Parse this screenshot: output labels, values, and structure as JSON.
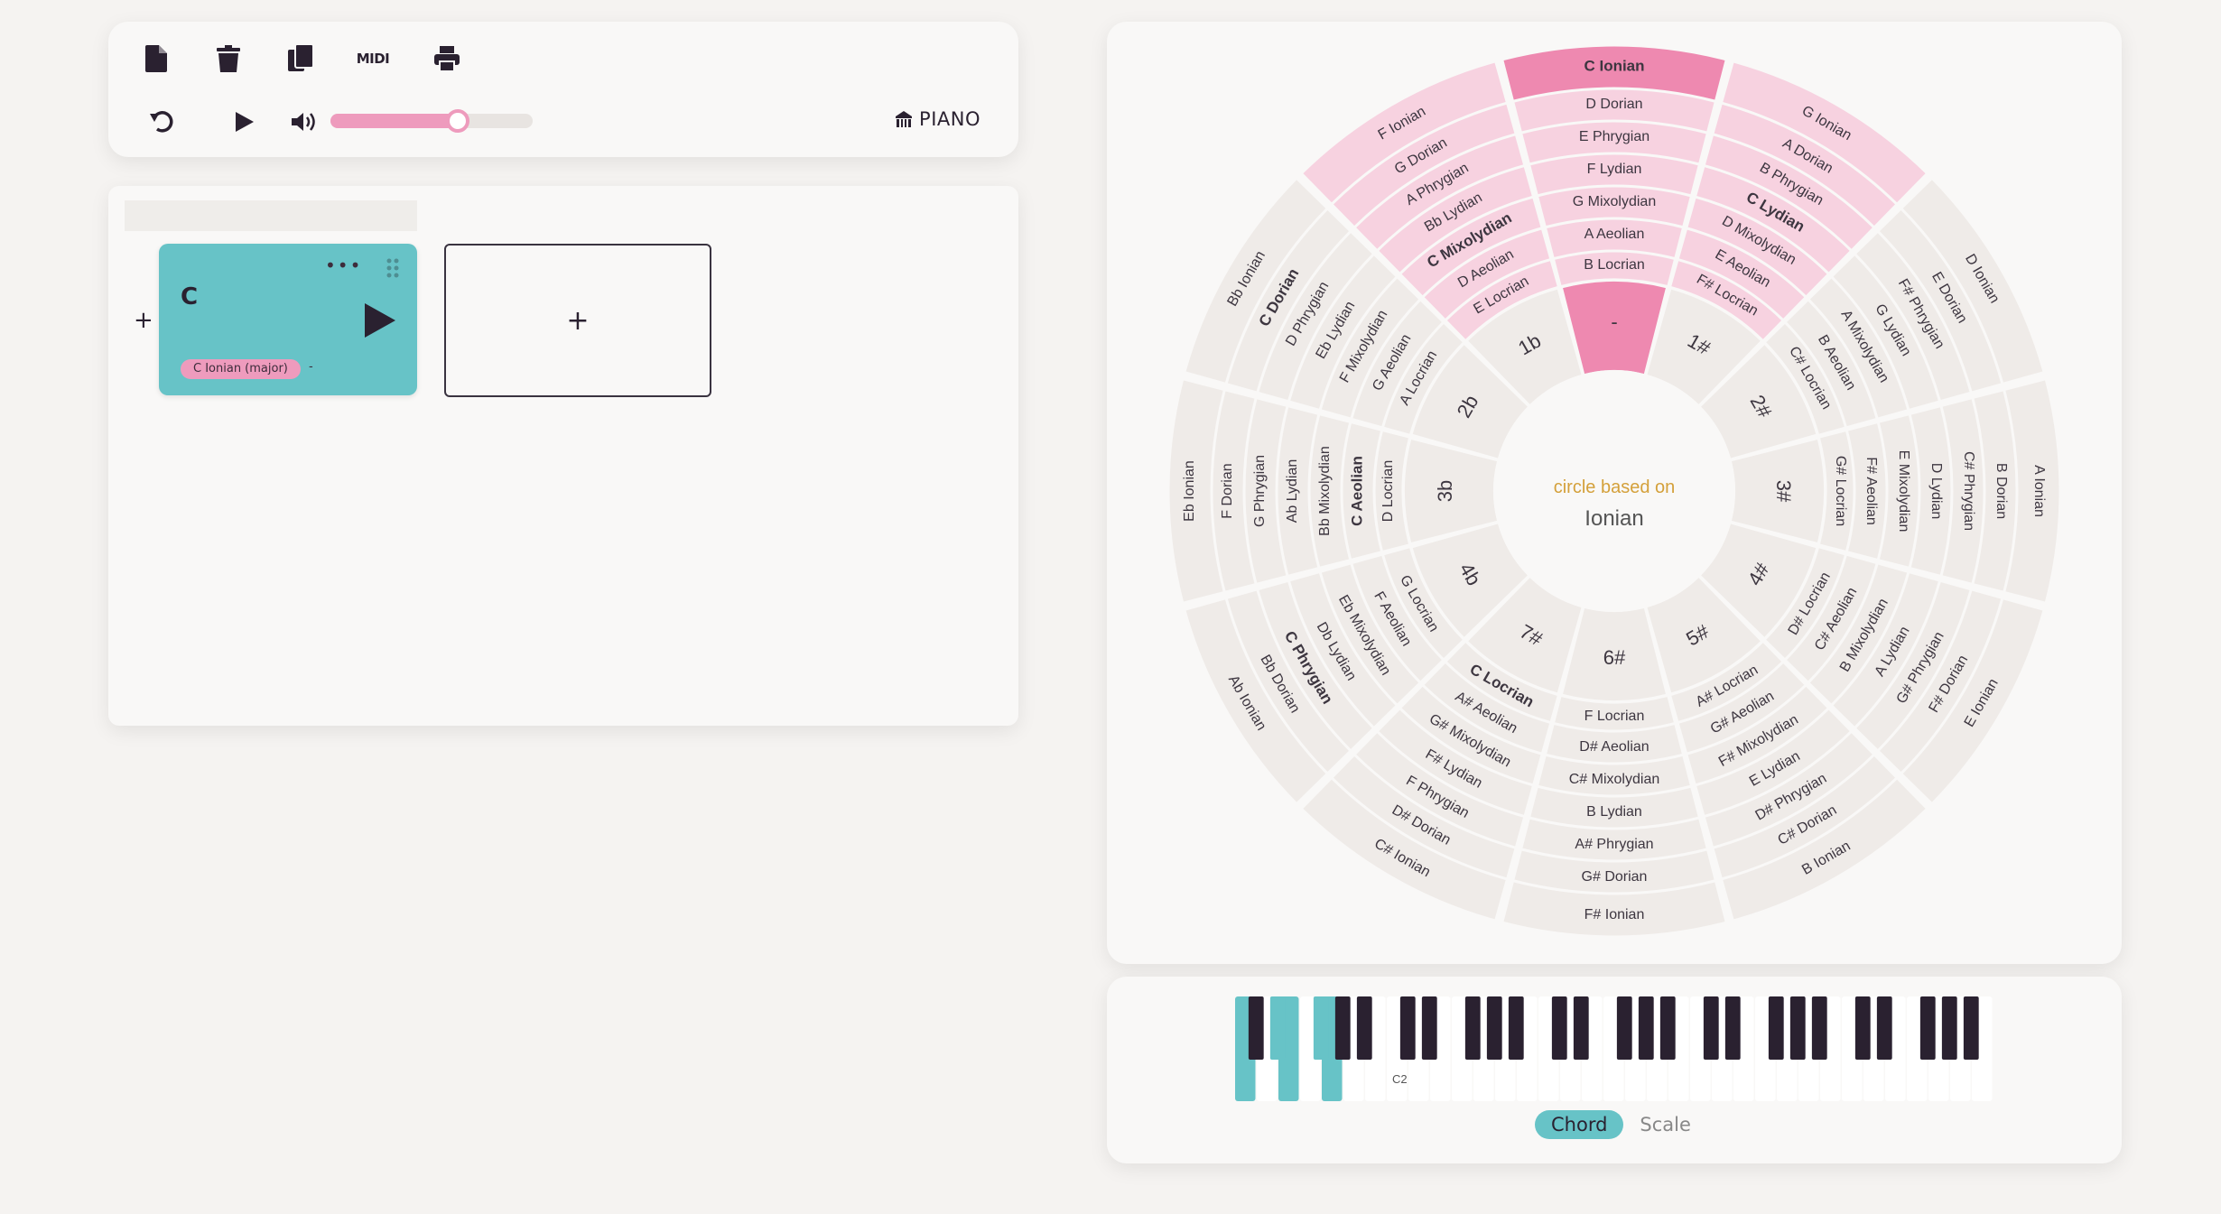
{
  "toolbar": {
    "midi_label": "MIDI",
    "instrument": "PIANO",
    "volume": 0.62
  },
  "progression": {
    "chord": {
      "name": "C",
      "tag": "C Ionian (major)",
      "extra": "-"
    },
    "add_symbol": "+"
  },
  "circle": {
    "center_caption": "circle based on",
    "center_mode": "Ionian",
    "highlight_color": "#ee89b0",
    "inner_labels": [
      "-",
      "1#",
      "2#",
      "3#",
      "4#",
      "5#",
      "6#",
      "7#",
      "4b",
      "3b",
      "2b",
      "1b"
    ],
    "mode_labels": [
      [
        "C Ionian",
        "D Dorian",
        "E Phrygian",
        "F Lydian",
        "G Mixolydian",
        "A Aeolian",
        "B Locrian"
      ],
      [
        "G Ionian",
        "A Dorian",
        "B Phrygian",
        "C Lydian",
        "D Mixolydian",
        "E Aeolian",
        "F# Locrian"
      ],
      [
        "D Ionian",
        "E Dorian",
        "F# Phrygian",
        "G Lydian",
        "A Mixolydian",
        "B Aeolian",
        "C# Locrian"
      ],
      [
        "A Ionian",
        "B Dorian",
        "C# Phrygian",
        "D Lydian",
        "E Mixolydian",
        "F# Aeolian",
        "G# Locrian"
      ],
      [
        "E Ionian",
        "F# Dorian",
        "G# Phrygian",
        "A Lydian",
        "B Mixolydian",
        "C# Aeolian",
        "D# Locrian"
      ],
      [
        "B Ionian",
        "C# Dorian",
        "D# Phrygian",
        "E Lydian",
        "F# Mixolydian",
        "G# Aeolian",
        "A# Locrian"
      ],
      [
        "F# Ionian",
        "G# Dorian",
        "A# Phrygian",
        "B Lydian",
        "C# Mixolydian",
        "D# Aeolian",
        "F Locrian"
      ],
      [
        "C# Ionian",
        "D# Dorian",
        "F Phrygian",
        "F# Lydian",
        "G# Mixolydian",
        "A# Aeolian",
        "C Locrian"
      ],
      [
        "Ab Ionian",
        "Bb Dorian",
        "C Phrygian",
        "Db Lydian",
        "Eb Mixolydian",
        "F Aeolian",
        "G Locrian"
      ],
      [
        "Eb Ionian",
        "F Dorian",
        "G Phrygian",
        "Ab Lydian",
        "Bb Mixolydian",
        "C Aeolian",
        "D Locrian"
      ],
      [
        "Bb Ionian",
        "C Dorian",
        "D Phrygian",
        "Eb Lydian",
        "F Mixolydian",
        "G Aeolian",
        "A Locrian"
      ],
      [
        "F Ionian",
        "G Dorian",
        "A Phrygian",
        "Bb Lydian",
        "C Mixolydian",
        "D Aeolian",
        "E Locrian"
      ]
    ]
  },
  "piano": {
    "key_label": "C\n2",
    "chord_toggle": "Chord",
    "scale_toggle": "Scale",
    "accent_color": "#67c3c7"
  }
}
